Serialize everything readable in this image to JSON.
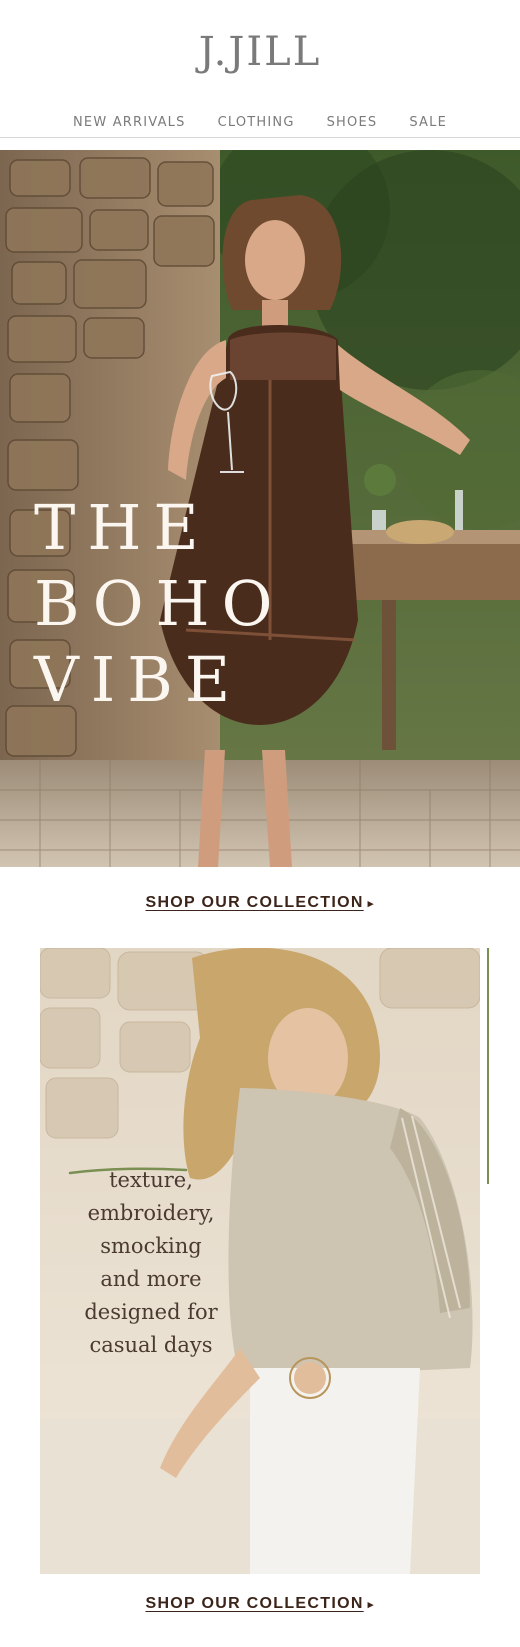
{
  "brand": {
    "logo": "J.JILL"
  },
  "nav": {
    "items": [
      "NEW ARRIVALS",
      "CLOTHING",
      "SHOES",
      "SALE"
    ]
  },
  "hero": {
    "headline": [
      "THE",
      "BOHO",
      "VIBE"
    ]
  },
  "cta1": {
    "label": "SHOP OUR COLLECTION",
    "chevron": "▸"
  },
  "panel2": {
    "lines": [
      "texture,",
      "embroidery,",
      "smocking",
      "and more",
      "designed for",
      "casual days"
    ]
  },
  "cta2": {
    "label": "SHOP OUR COLLECTION",
    "chevron": "▸"
  },
  "colors": {
    "accent_green": "#7a8f52",
    "cta_brown": "#3b2419"
  }
}
